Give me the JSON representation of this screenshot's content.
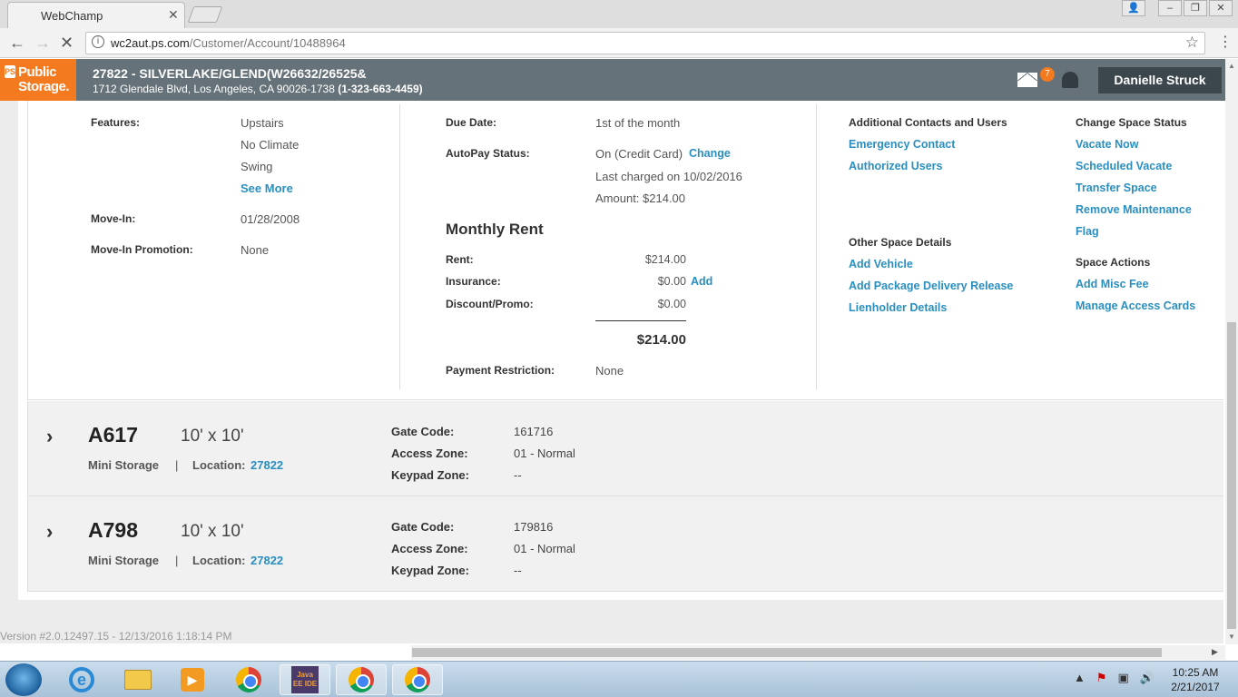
{
  "browser": {
    "tab_title": "WebChamp",
    "url_domain": "wc2aut.ps.com",
    "url_path": "/Customer/Account/10488964"
  },
  "header": {
    "logo_line1": "Public",
    "logo_line2": "Storage.",
    "logo_mark": "PS",
    "store_title": "27822 - SILVERLAKE/GLEND(W26632/26525&",
    "store_address": "1712 Glendale Blvd, Los Angeles, CA 90026-1738",
    "store_phone": "(1-323-663-4459)",
    "mail_count": "7",
    "user_name": "Danielle Struck"
  },
  "space_details": {
    "features_label": "Features:",
    "features": [
      "Upstairs",
      "No Climate",
      "Swing"
    ],
    "see_more": "See More",
    "move_in_label": "Move-In:",
    "move_in_value": "01/28/2008",
    "promo_label": "Move-In Promotion:",
    "promo_value": "None",
    "due_date_label": "Due Date:",
    "due_date_value": "1st of the month",
    "autopay_label": "AutoPay Status:",
    "autopay_value": "On (Credit Card)",
    "autopay_change": "Change",
    "last_charged": "Last charged on 10/02/2016",
    "amount": "Amount: $214.00",
    "rent_heading": "Monthly Rent",
    "rent_label": "Rent:",
    "rent_value": "$214.00",
    "insurance_label": "Insurance:",
    "insurance_value": "$0.00",
    "insurance_add": "Add",
    "discount_label": "Discount/Promo:",
    "discount_value": "$0.00",
    "total": "$214.00",
    "restriction_label": "Payment Restriction:",
    "restriction_value": "None"
  },
  "actions": {
    "contacts_title": "Additional Contacts and Users",
    "emergency_contact": "Emergency Contact",
    "authorized_users": "Authorized Users",
    "other_title": "Other Space Details",
    "add_vehicle": "Add Vehicle",
    "add_package": "Add Package Delivery Release",
    "lienholder": "Lienholder Details",
    "change_status_title": "Change Space Status",
    "vacate_now": "Vacate Now",
    "scheduled_vacate": "Scheduled Vacate",
    "transfer_space": "Transfer Space",
    "remove_maintenance": "Remove Maintenance",
    "flag": "Flag",
    "space_actions_title": "Space Actions",
    "add_misc_fee": "Add Misc Fee",
    "manage_access_cards": "Manage Access Cards"
  },
  "units": [
    {
      "id": "A617",
      "size": "10' x 10'",
      "type": "Mini Storage",
      "pipe": "|",
      "location_label": "Location:",
      "location": "27822",
      "gate_code_label": "Gate Code:",
      "gate_code": "161716",
      "access_zone_label": "Access Zone:",
      "access_zone": "01 - Normal",
      "keypad_zone_label": "Keypad Zone:",
      "keypad_zone": "--"
    },
    {
      "id": "A798",
      "size": "10' x 10'",
      "type": "Mini Storage",
      "pipe": "|",
      "location_label": "Location:",
      "location": "27822",
      "gate_code_label": "Gate Code:",
      "gate_code": "179816",
      "access_zone_label": "Access Zone:",
      "access_zone": "01 - Normal",
      "keypad_zone_label": "Keypad Zone:",
      "keypad_zone": "--"
    }
  ],
  "footer": {
    "version": "Version #2.0.12497.15 - 12/13/2016 1:18:14 PM"
  },
  "taskbar": {
    "time": "10:25 AM",
    "date": "2/21/2017",
    "java_label": "Java EE IDE"
  },
  "colors": {
    "brand_orange": "#f47a20",
    "header_gray": "#667279",
    "link_blue": "#2a8fc0"
  }
}
